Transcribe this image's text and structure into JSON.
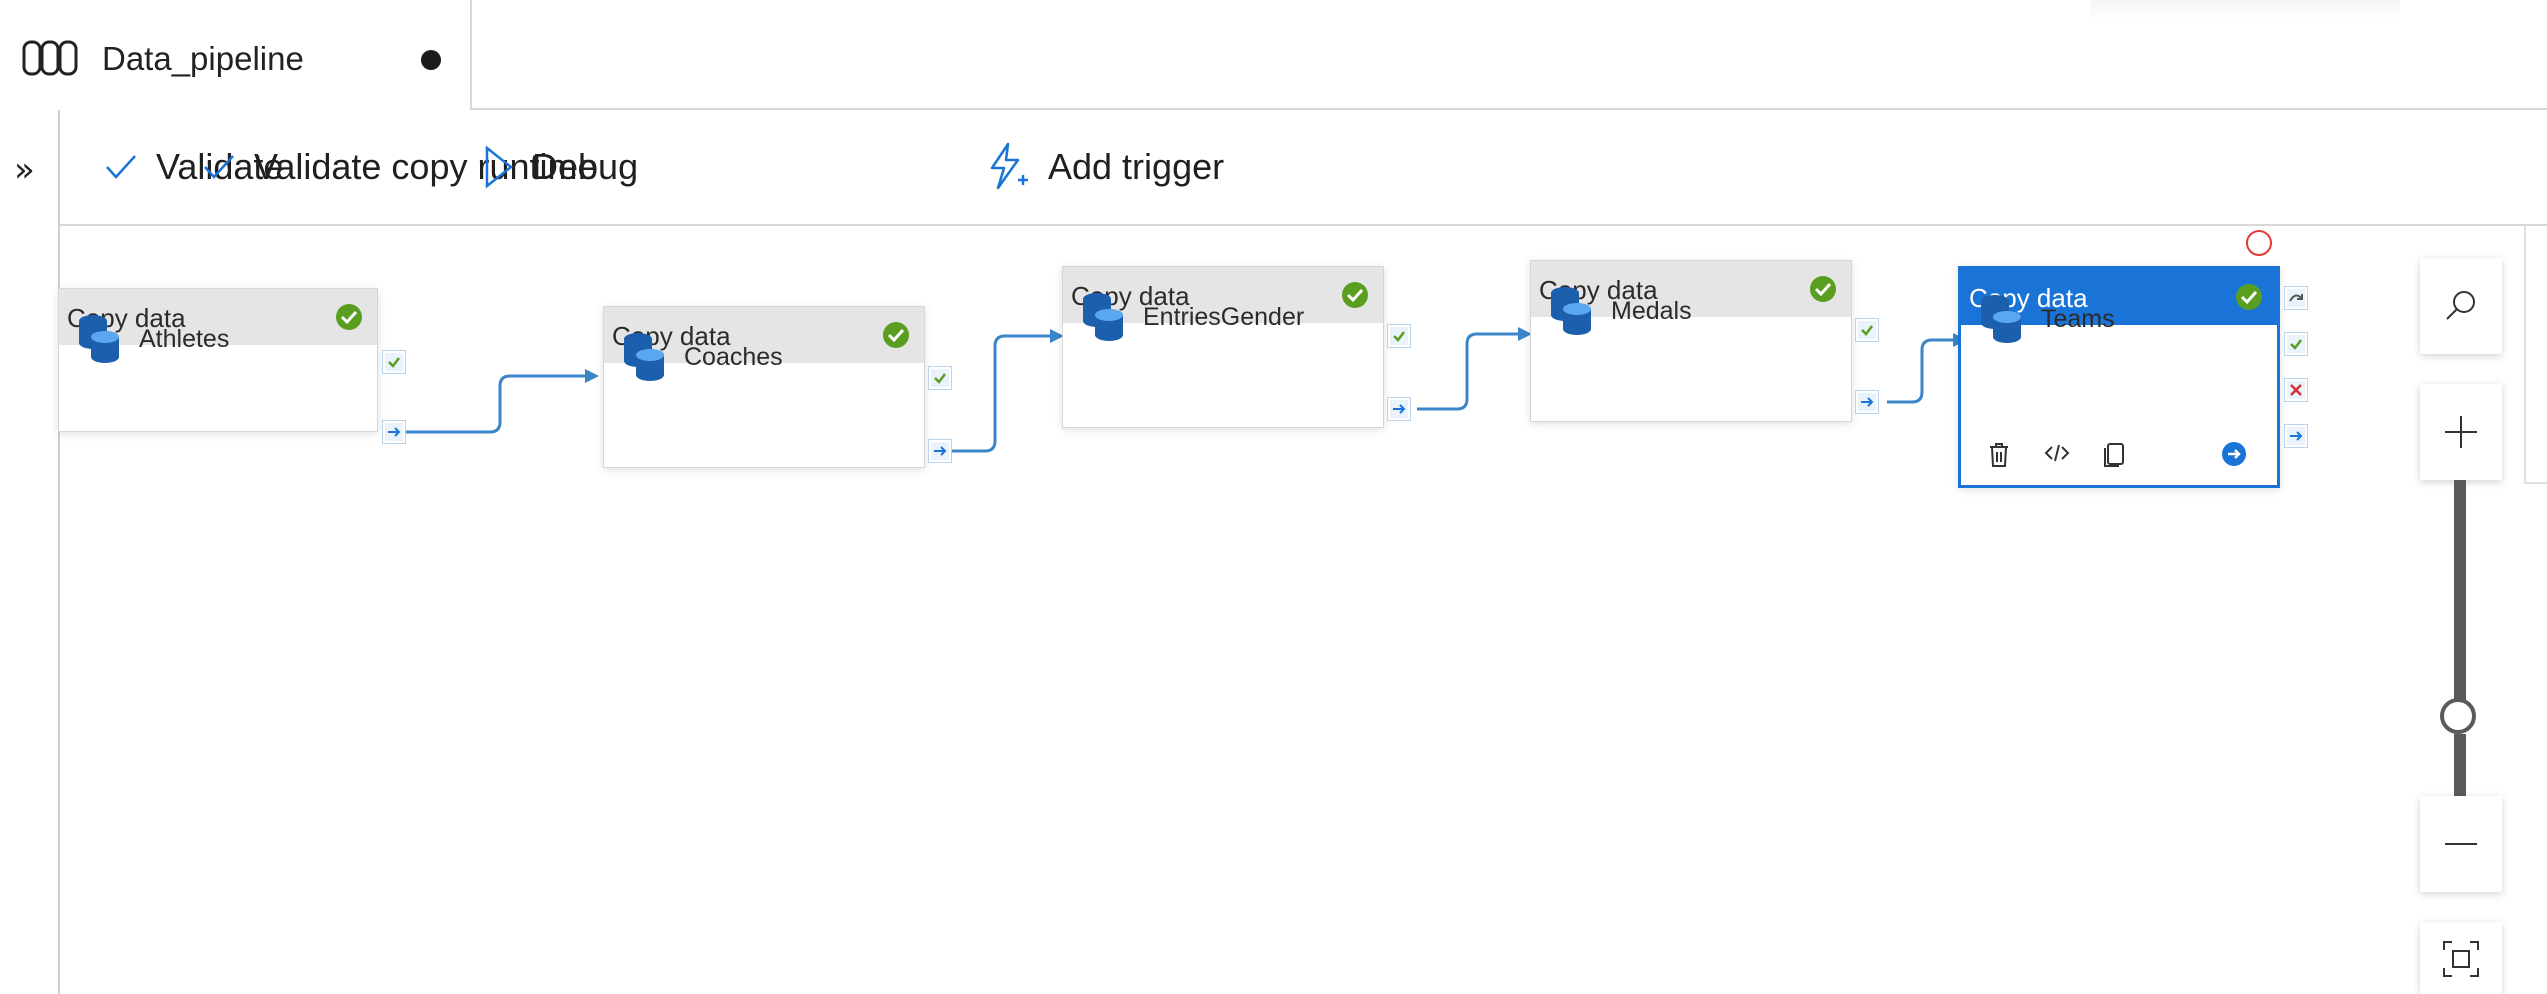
{
  "tab": {
    "title": "Data_pipeline",
    "icon": "pipeline-icon",
    "unsaved": true
  },
  "rail": {
    "expand_icon": "double-chevron-right-icon"
  },
  "toolbar": {
    "validate": "Validate",
    "validate_runtime": "Validate copy runtime",
    "debug": "Debug",
    "add_trigger": "Add trigger"
  },
  "activities": [
    {
      "type": "Copy data",
      "name": "Athletes",
      "status": "valid"
    },
    {
      "type": "Copy data",
      "name": "Coaches",
      "status": "valid"
    },
    {
      "type": "Copy data",
      "name": "EntriesGender",
      "status": "valid"
    },
    {
      "type": "Copy data",
      "name": "Medals",
      "status": "valid"
    },
    {
      "type": "Copy data",
      "name": "Teams",
      "status": "valid",
      "selected": true
    }
  ],
  "selected_actions": [
    "delete-icon",
    "code-icon",
    "copy-icon",
    "go-icon"
  ],
  "colors": {
    "accent": "#1a73d6",
    "success": "#5a9e1f",
    "failure": "#d13438",
    "connector": "#3a86c8",
    "header": "#e5e5e5"
  },
  "zoom_controls": [
    "search-icon",
    "zoom-in-icon",
    "zoom-slider",
    "zoom-out-icon",
    "fit-to-screen-icon"
  ]
}
